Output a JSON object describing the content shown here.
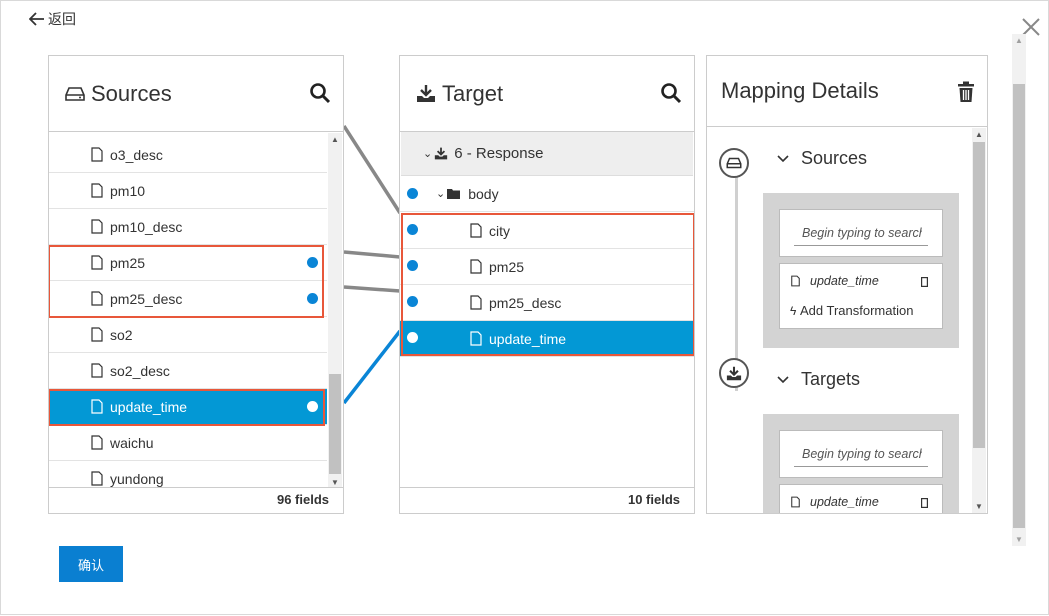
{
  "nav": {
    "back_label": "返回"
  },
  "sources": {
    "title": "Sources",
    "items": [
      "o3_desc",
      "pm10",
      "pm10_desc",
      "pm25",
      "pm25_desc",
      "so2",
      "so2_desc",
      "update_time",
      "waichu",
      "yundong"
    ],
    "footer": "96 fields"
  },
  "target": {
    "title": "Target",
    "group": "6 - Response",
    "folder": "body",
    "items": [
      "city",
      "pm25",
      "pm25_desc",
      "update_time"
    ],
    "footer": "10 fields"
  },
  "mapping": {
    "title": "Mapping Details",
    "sources_label": "Sources",
    "targets_label": "Targets",
    "search_placeholder": "Begin typing to search",
    "source_field": "update_time",
    "target_field": "update_time",
    "add_transformation": "Add Transformation"
  },
  "actions": {
    "confirm_label": "确认"
  },
  "colors": {
    "accent": "#0398d5",
    "highlight": "#e8573a",
    "dot": "#0a85d6",
    "button": "#0a7fd1"
  }
}
